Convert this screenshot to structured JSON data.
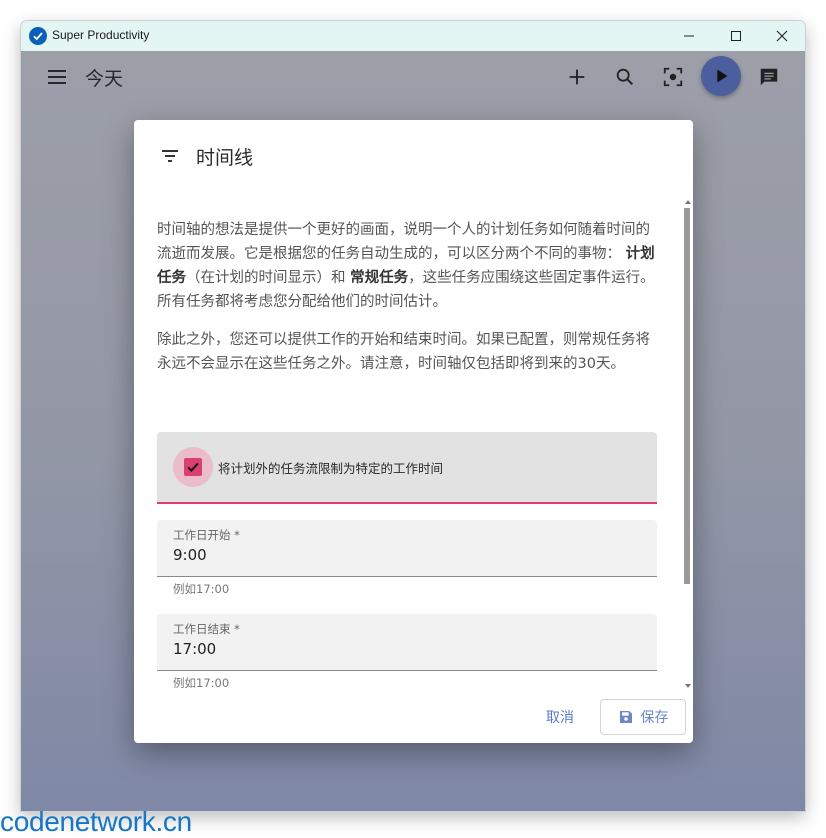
{
  "window": {
    "title": "Super Productivity"
  },
  "app": {
    "page_title": "今天"
  },
  "dialog": {
    "title": "时间线",
    "paragraph1": {
      "part1": "时间轴的想法是提供一个更好的画面，说明一个人的计划任务如何随着时间的流逝而发展。它是根据您的任务自动生成的，可以区分两个不同的事物：",
      "bold1": "计划任务",
      "part2": "（在计划的时间显示）和",
      "bold2": "常规任务",
      "part3": "，这些任务应围绕这些固定事件运行。所有任务都将考虑您分配给他们的时间估计。"
    },
    "paragraph2": "除此之外，您还可以提供工作的开始和结束时间。如果已配置，则常规任务将永远不会显示在这些任务之外。请注意，时间轴仅包括即将到来的30天。",
    "checkbox": {
      "label": "将计划外的任务流限制为特定的工作时间",
      "checked": true
    },
    "start_field": {
      "label": "工作日开始 *",
      "value": "9:00",
      "hint": "例如17:00"
    },
    "end_field": {
      "label": "工作日结束 *",
      "value": "17:00",
      "hint": "例如17:00"
    },
    "cancel_label": "取消",
    "save_label": "保存"
  },
  "watermark": "codenetwork.cn",
  "colors": {
    "accent": "#d93f73",
    "primary": "#4b5e9e",
    "link": "#5a7bc9"
  }
}
